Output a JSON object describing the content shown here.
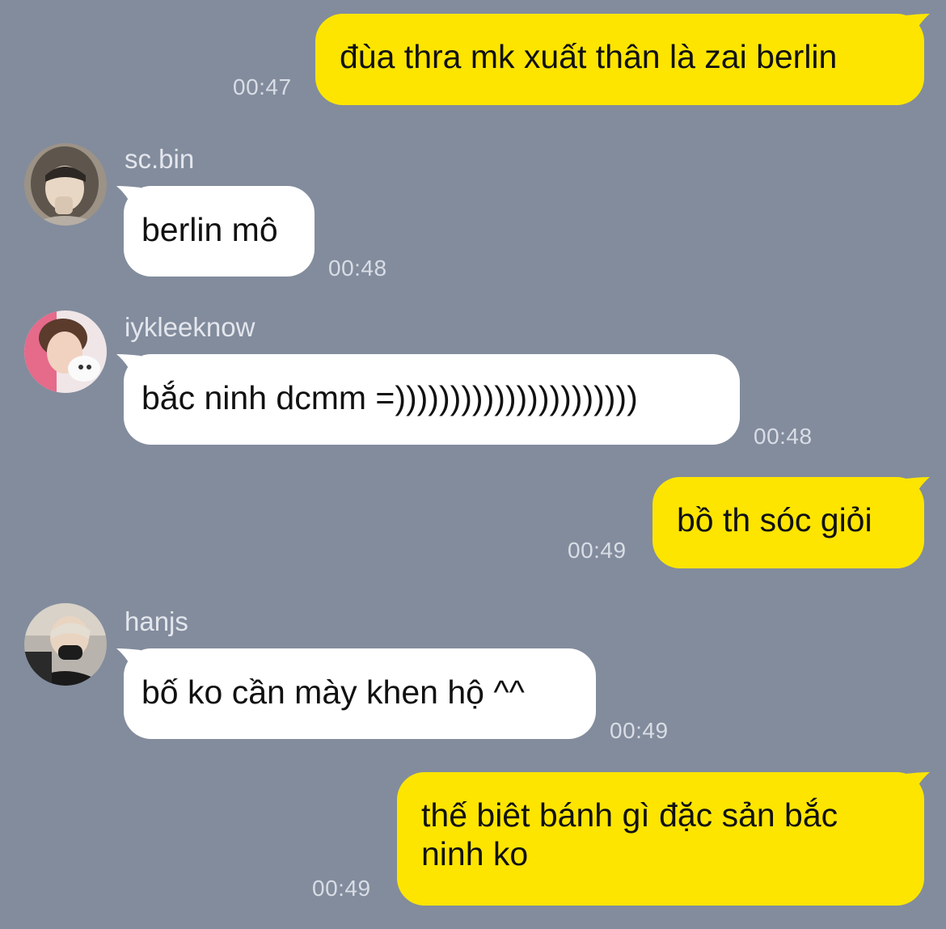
{
  "colors": {
    "background": "#828c9d",
    "my_bubble": "#fde500",
    "their_bubble": "#ffffff",
    "timestamp": "#d9dde5",
    "sender_name": "#e3e6ec"
  },
  "messages": [
    {
      "direction": "outgoing",
      "text": "đùa thra mk xuất thân là zai berlin",
      "time": "00:47"
    },
    {
      "direction": "incoming",
      "sender": "sc.bin",
      "avatar": "avatar-sc-bin",
      "text": "berlin mô",
      "time": "00:48"
    },
    {
      "direction": "incoming",
      "sender": "iykleeknow",
      "avatar": "avatar-iykleeknow",
      "text": "bắc ninh dcmm =))))))))))))))))))))))",
      "time": "00:48"
    },
    {
      "direction": "outgoing",
      "text": "bồ th sóc giỏi",
      "time": "00:49"
    },
    {
      "direction": "incoming",
      "sender": "hanjs",
      "avatar": "avatar-hanjs",
      "text": "bố ko cần mày khen hộ ^^",
      "time": "00:49"
    },
    {
      "direction": "outgoing",
      "text_lines": [
        "thế biêt bánh gì đặc sản bắc",
        "ninh ko"
      ],
      "time": "00:49"
    }
  ]
}
